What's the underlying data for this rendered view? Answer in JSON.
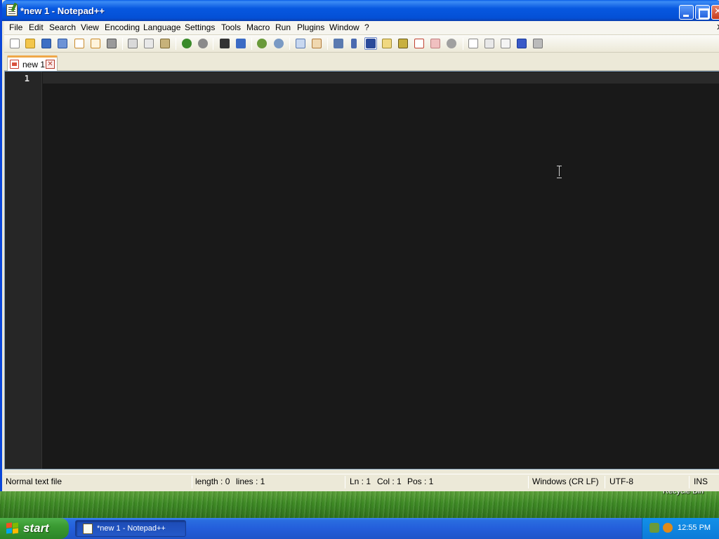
{
  "window": {
    "title": "*new 1 - Notepad++"
  },
  "menu": [
    {
      "label": "File"
    },
    {
      "label": "Edit"
    },
    {
      "label": "Search"
    },
    {
      "label": "View"
    },
    {
      "label": "Encoding"
    },
    {
      "label": "Language"
    },
    {
      "label": "Settings"
    },
    {
      "label": "Tools"
    },
    {
      "label": "Macro"
    },
    {
      "label": "Run"
    },
    {
      "label": "Plugins"
    },
    {
      "label": "Window"
    },
    {
      "label": "?"
    }
  ],
  "menu_close": "x",
  "toolbar": {
    "icons": [
      "new-file-icon",
      "open-file-icon",
      "save-icon",
      "save-all-icon",
      "close-icon",
      "close-all-icon",
      "print-icon",
      "cut-icon",
      "copy-icon",
      "paste-icon",
      "undo-icon",
      "redo-icon",
      "find-icon",
      "replace-icon",
      "zoom-in-icon",
      "zoom-out-icon",
      "sync-vertical-icon",
      "sync-horizontal-icon",
      "word-wrap-icon",
      "show-all-chars-icon",
      "indent-guide-icon",
      "doc-map-icon",
      "function-list-icon",
      "folder-workspace-icon",
      "monitoring-icon",
      "record-macro-icon",
      "stop-record-icon",
      "play-macro-icon",
      "run-macro-multiple-icon",
      "save-macro-icon"
    ]
  },
  "tabs": [
    {
      "label": "new 1",
      "close": "✕"
    }
  ],
  "editor": {
    "line_numbers": [
      "1"
    ],
    "content": ""
  },
  "status": {
    "file_type": "Normal text file",
    "length": "length : 0",
    "lines": "lines : 1",
    "ln": "Ln : 1",
    "col": "Col : 1",
    "pos": "Pos : 1",
    "eol": "Windows (CR LF)",
    "encoding": "UTF-8",
    "mode": "INS"
  },
  "desktop": {
    "recycle_bin_label": "Recycle Bin"
  },
  "taskbar": {
    "start_label": "start",
    "task_label": "*new 1 - Notepad++",
    "clock": "12:55 PM"
  },
  "colors": {
    "titlebar": "#0758e0",
    "editor_bg": "#191919",
    "gutter_bg": "#262626",
    "tab_accent": "#f0a848",
    "start_green": "#3a9a32"
  }
}
